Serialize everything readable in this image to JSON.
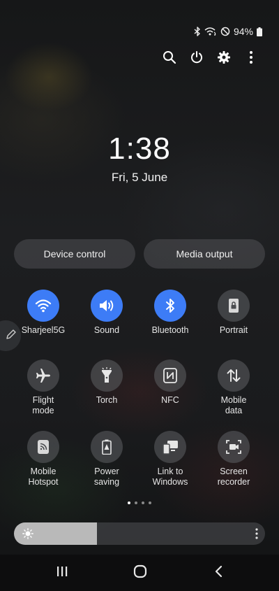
{
  "status_bar": {
    "battery": "94%",
    "icons": [
      "bluetooth-icon",
      "wifi-calling-icon",
      "do-not-disturb-icon",
      "battery-icon"
    ]
  },
  "top_icons": [
    "search-icon",
    "power-icon",
    "settings-icon",
    "more-icon"
  ],
  "clock": {
    "time": "1:38",
    "date": "Fri, 5 June"
  },
  "pills": {
    "device_control": "Device control",
    "media_output": "Media output"
  },
  "tiles": [
    {
      "label": "Sharjeel5G",
      "icon": "wifi-icon",
      "active": true
    },
    {
      "label": "Sound",
      "icon": "sound-icon",
      "active": true
    },
    {
      "label": "Bluetooth",
      "icon": "bluetooth-icon",
      "active": true
    },
    {
      "label": "Portrait",
      "icon": "portrait-lock-icon",
      "active": false
    },
    {
      "label": "Flight mode",
      "icon": "airplane-icon",
      "active": false
    },
    {
      "label": "Torch",
      "icon": "torch-icon",
      "active": false
    },
    {
      "label": "NFC",
      "icon": "nfc-icon",
      "active": false
    },
    {
      "label": "Mobile data",
      "icon": "mobile-data-icon",
      "active": false
    },
    {
      "label": "Mobile Hotspot",
      "icon": "hotspot-icon",
      "active": false
    },
    {
      "label": "Power saving",
      "icon": "power-saving-icon",
      "active": false
    },
    {
      "label": "Link to Windows",
      "icon": "link-to-windows-icon",
      "active": false
    },
    {
      "label": "Screen recorder",
      "icon": "screen-recorder-icon",
      "active": false
    }
  ],
  "page_indicator": {
    "pages": 4,
    "current": 1
  },
  "brightness": {
    "level": 0.33
  },
  "nav": [
    "recent-apps-icon",
    "home-icon",
    "back-icon"
  ],
  "colors": {
    "accent": "#3d7cf6",
    "tile_off": "#5f6164",
    "brightness_fill": "#b9b9b9"
  }
}
